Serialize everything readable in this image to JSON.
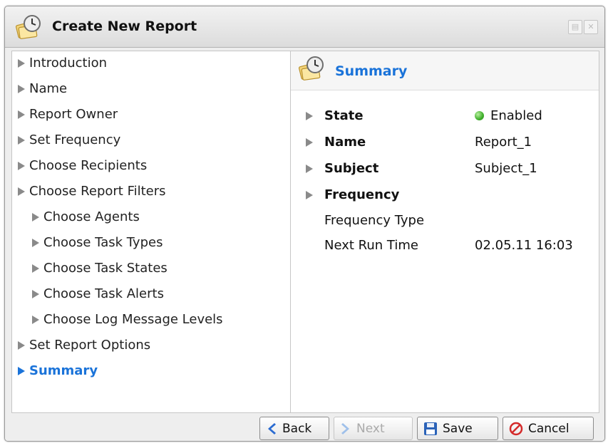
{
  "window": {
    "title": "Create New Report",
    "restore_icon": "restore-icon",
    "close_icon": "close-icon",
    "title_icon": "report-clock-icon"
  },
  "nav": {
    "items": [
      {
        "label": "Introduction",
        "level": 0,
        "active": false
      },
      {
        "label": "Name",
        "level": 0,
        "active": false
      },
      {
        "label": "Report Owner",
        "level": 0,
        "active": false
      },
      {
        "label": "Set Frequency",
        "level": 0,
        "active": false
      },
      {
        "label": "Choose Recipients",
        "level": 0,
        "active": false
      },
      {
        "label": "Choose Report Filters",
        "level": 0,
        "active": false
      },
      {
        "label": "Choose Agents",
        "level": 1,
        "active": false
      },
      {
        "label": "Choose Task Types",
        "level": 1,
        "active": false
      },
      {
        "label": "Choose Task States",
        "level": 1,
        "active": false
      },
      {
        "label": "Choose Task Alerts",
        "level": 1,
        "active": false
      },
      {
        "label": "Choose Log Message Levels",
        "level": 1,
        "active": false
      },
      {
        "label": "Set Report Options",
        "level": 0,
        "active": false
      },
      {
        "label": "Summary",
        "level": 0,
        "active": true
      }
    ]
  },
  "summary": {
    "title": "Summary",
    "rows": [
      {
        "label": "State",
        "value": "Enabled",
        "bold": true,
        "expander": true,
        "status": "enabled"
      },
      {
        "label": "Name",
        "value": "Report_1",
        "bold": true,
        "expander": true
      },
      {
        "label": "Subject",
        "value": "Subject_1",
        "bold": true,
        "expander": true
      },
      {
        "label": "Frequency",
        "value": "",
        "bold": true,
        "expander": true
      },
      {
        "label": "Frequency Type",
        "value": "",
        "bold": false,
        "expander": false
      },
      {
        "label": "Next Run Time",
        "value": "02.05.11 16:03",
        "bold": false,
        "expander": false
      }
    ]
  },
  "footer": {
    "back_label": "Back",
    "next_label": "Next",
    "save_label": "Save",
    "cancel_label": "Cancel"
  },
  "colors": {
    "accent": "#1a73d9",
    "status_enabled": "#3eae2a"
  }
}
